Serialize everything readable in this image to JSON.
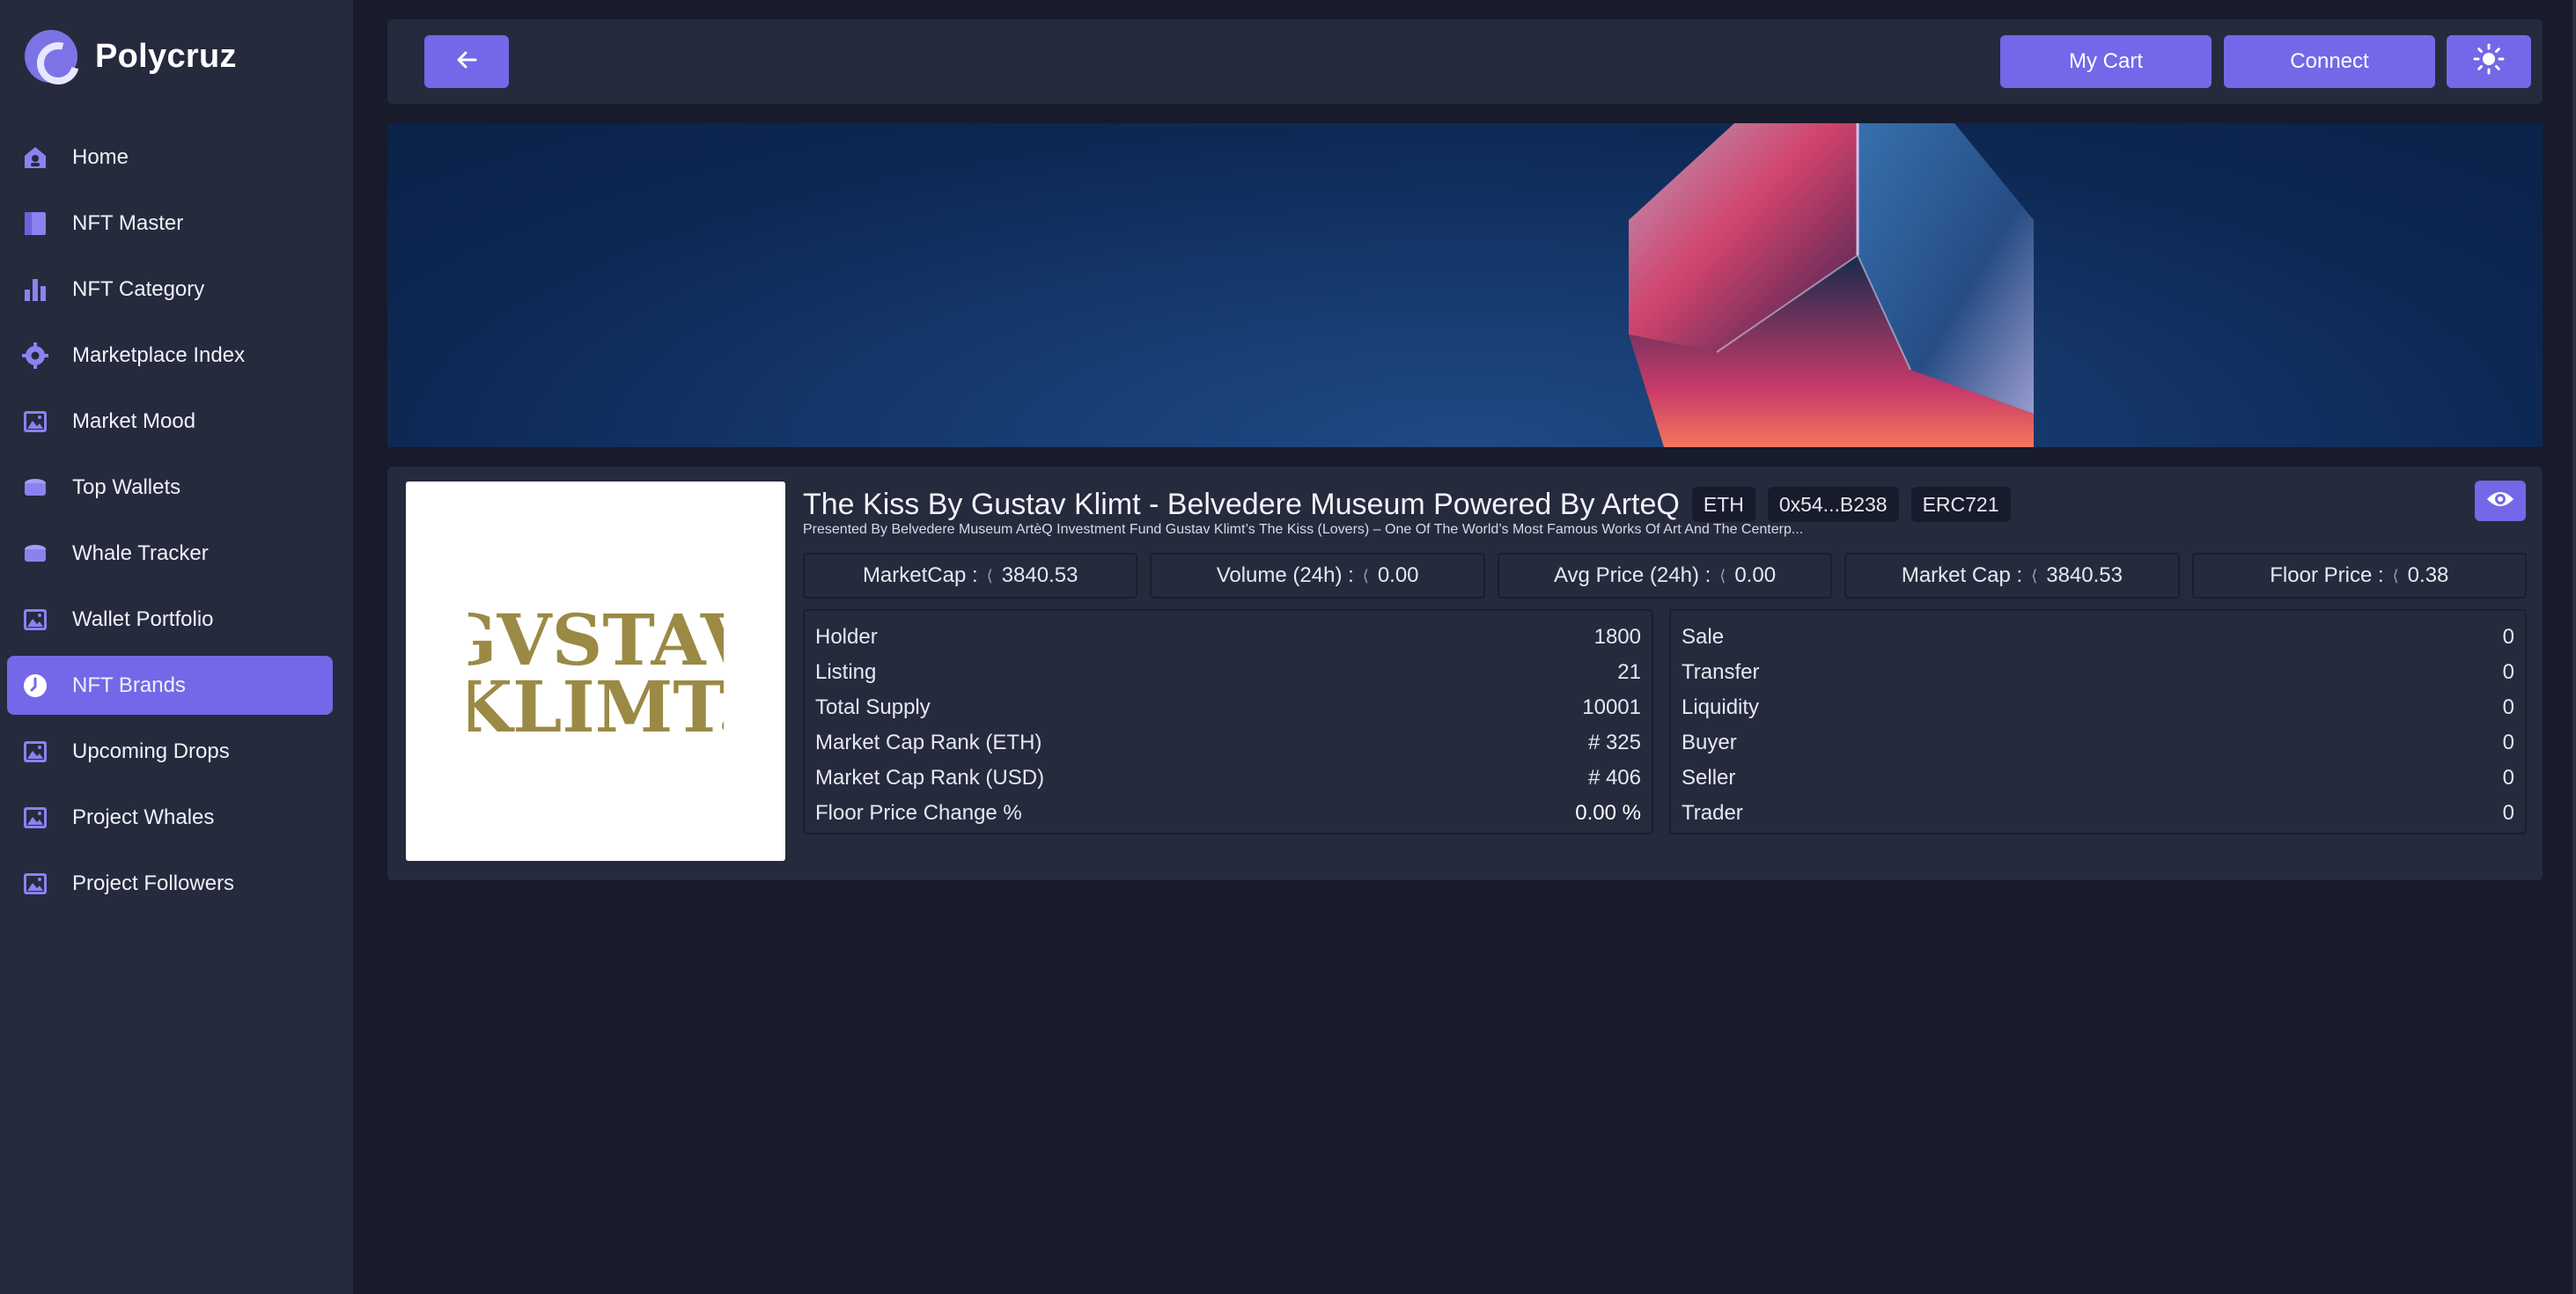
{
  "brand": {
    "name": "Polycruz"
  },
  "sidebar": {
    "items": [
      {
        "label": "Home",
        "icon": "home-icon",
        "active": false
      },
      {
        "label": "NFT Master",
        "icon": "book-icon",
        "active": false
      },
      {
        "label": "NFT Category",
        "icon": "bar-chart-icon",
        "active": false
      },
      {
        "label": "Marketplace Index",
        "icon": "gear-icon",
        "active": false
      },
      {
        "label": "Market Mood",
        "icon": "image-icon",
        "active": false
      },
      {
        "label": "Top Wallets",
        "icon": "wallet-icon",
        "active": false
      },
      {
        "label": "Whale Tracker",
        "icon": "wallet-icon",
        "active": false
      },
      {
        "label": "Wallet Portfolio",
        "icon": "image-icon",
        "active": false
      },
      {
        "label": "NFT Brands",
        "icon": "clock-icon",
        "active": true
      },
      {
        "label": "Upcoming Drops",
        "icon": "image-icon",
        "active": false
      },
      {
        "label": "Project Whales",
        "icon": "image-icon",
        "active": false
      },
      {
        "label": "Project Followers",
        "icon": "image-icon",
        "active": false
      }
    ]
  },
  "topbar": {
    "back_icon": "arrow-left-icon",
    "cart_label": "My Cart",
    "connect_label": "Connect",
    "theme_icon": "sun-icon"
  },
  "collection": {
    "title": "The Kiss By Gustav Klimt - Belvedere Museum Powered By ArteQ",
    "chain": "ETH",
    "address": "0x54...B238",
    "standard": "ERC721",
    "description": "Presented By Belvedere Museum ArtèQ Investment Fund Gustav Klimt’s The Kiss (Lovers) – One Of The World’s Most Famous Works Of Art And The Centerp...",
    "image_text_line1": "GVSTAV",
    "image_text_line2": "KLIMT."
  },
  "stats": [
    {
      "label": "MarketCap :",
      "value": "3840.53"
    },
    {
      "label": "Volume (24h) :",
      "value": "0.00"
    },
    {
      "label": "Avg Price (24h) :",
      "value": "0.00"
    },
    {
      "label": "Market Cap :",
      "value": "3840.53"
    },
    {
      "label": "Floor Price :",
      "value": "0.38"
    }
  ],
  "left_table": [
    {
      "label": "Holder",
      "value": "1800"
    },
    {
      "label": "Listing",
      "value": "21"
    },
    {
      "label": "Total Supply",
      "value": "10001"
    },
    {
      "label": "Market Cap Rank (ETH)",
      "value": "# 325"
    },
    {
      "label": "Market Cap Rank (USD)",
      "value": "# 406"
    },
    {
      "label": "Floor Price Change %",
      "value": "0.00 %"
    }
  ],
  "right_table": [
    {
      "label": "Sale",
      "value": "0"
    },
    {
      "label": "Transfer",
      "value": "0"
    },
    {
      "label": "Liquidity",
      "value": "0"
    },
    {
      "label": "Buyer",
      "value": "0"
    },
    {
      "label": "Seller",
      "value": "0"
    },
    {
      "label": "Trader",
      "value": "0"
    }
  ],
  "colors": {
    "accent": "#7468e8",
    "sidebar": "#262a3d",
    "background": "#171b2b"
  }
}
